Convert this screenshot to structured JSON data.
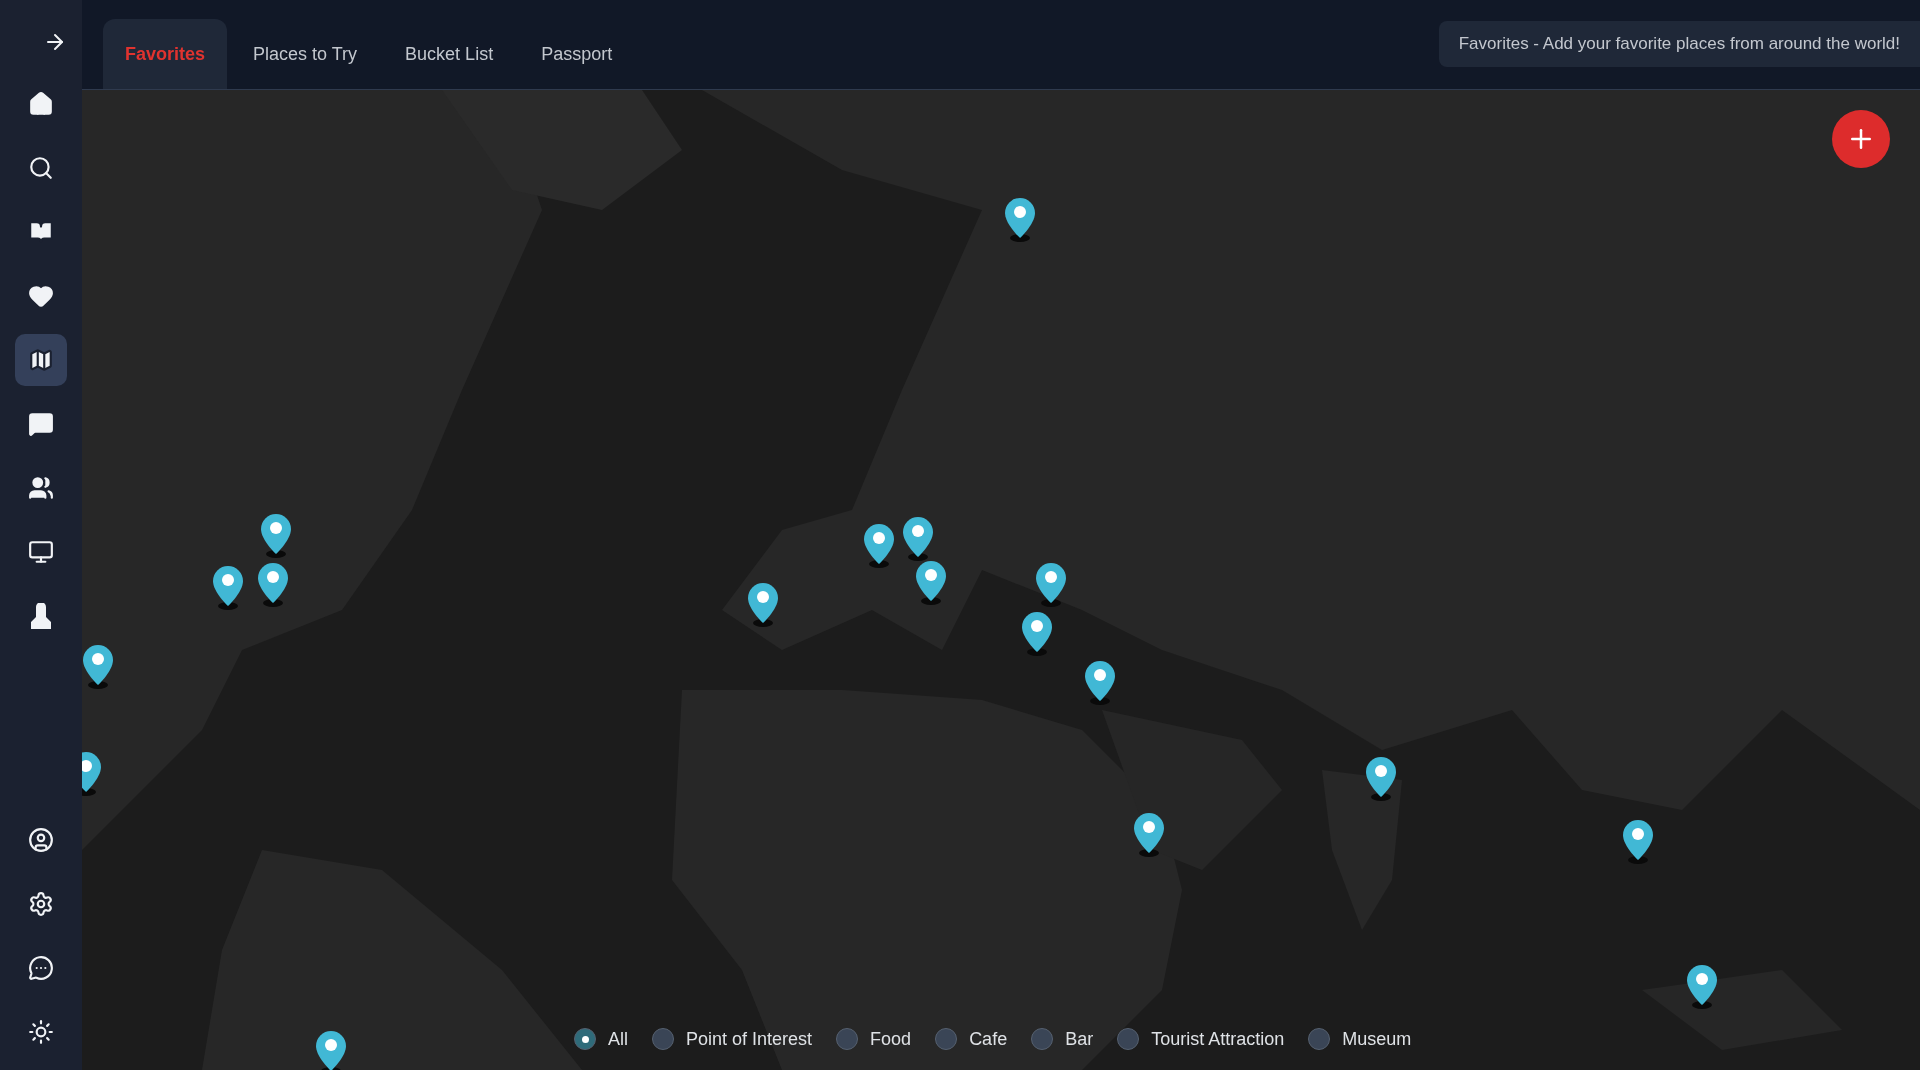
{
  "sidebar": {
    "items": [
      {
        "selected": false
      },
      {
        "selected": false
      },
      {
        "selected": false
      },
      {
        "selected": false
      },
      {
        "selected": true
      },
      {
        "selected": false
      },
      {
        "selected": false
      },
      {
        "selected": false
      },
      {
        "selected": false
      }
    ],
    "bottom_items": [
      {
        "selected": false
      },
      {
        "selected": false
      },
      {
        "selected": false
      },
      {
        "selected": false
      }
    ]
  },
  "tabs": [
    {
      "label": "Favorites",
      "selected": true
    },
    {
      "label": "Places to Try",
      "selected": false
    },
    {
      "label": "Bucket List",
      "selected": false
    },
    {
      "label": "Passport",
      "selected": false
    }
  ],
  "description": "Favorites - Add your favorite places from around the world!",
  "filters": [
    {
      "label": "All",
      "selected": true
    },
    {
      "label": "Point of Interest",
      "selected": false
    },
    {
      "label": "Food",
      "selected": false
    },
    {
      "label": "Cafe",
      "selected": false
    },
    {
      "label": "Bar",
      "selected": false
    },
    {
      "label": "Tourist Attraction",
      "selected": false
    },
    {
      "label": "Museum",
      "selected": false
    }
  ]
}
